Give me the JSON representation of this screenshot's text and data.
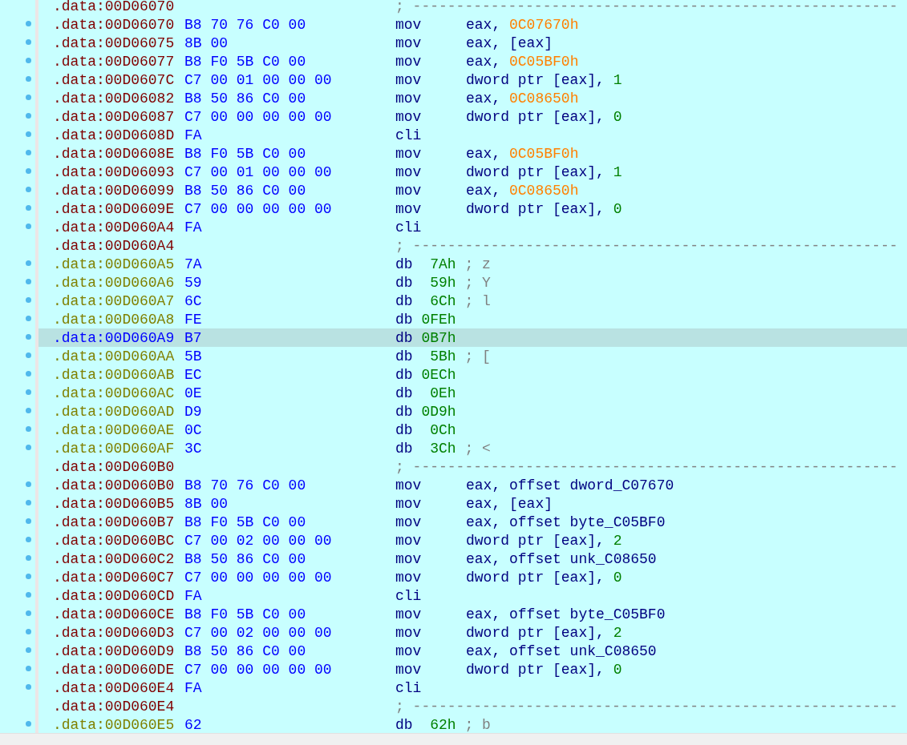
{
  "listing": [
    {
      "kind": "separator",
      "selected": false,
      "address": ".data:00D06070",
      "comment": "; --------------------------------------------------------"
    },
    {
      "kind": "code",
      "selected": false,
      "address": ".data:00D06070",
      "bytes": "B8 70 76 C0 00",
      "mnemonic": "mov",
      "operands": [
        {
          "text": "eax, ",
          "kind": "plain"
        },
        {
          "text": "0C07670h",
          "kind": "address"
        }
      ]
    },
    {
      "kind": "code",
      "selected": false,
      "address": ".data:00D06075",
      "bytes": "8B 00",
      "mnemonic": "mov",
      "operands": [
        {
          "text": "eax, [eax]",
          "kind": "plain"
        }
      ]
    },
    {
      "kind": "code",
      "selected": false,
      "address": ".data:00D06077",
      "bytes": "B8 F0 5B C0 00",
      "mnemonic": "mov",
      "operands": [
        {
          "text": "eax, ",
          "kind": "plain"
        },
        {
          "text": "0C05BF0h",
          "kind": "address"
        }
      ]
    },
    {
      "kind": "code",
      "selected": false,
      "address": ".data:00D0607C",
      "bytes": "C7 00 01 00 00 00",
      "mnemonic": "mov",
      "operands": [
        {
          "text": "dword ptr [eax], ",
          "kind": "plain"
        },
        {
          "text": "1",
          "kind": "number"
        }
      ]
    },
    {
      "kind": "code",
      "selected": false,
      "address": ".data:00D06082",
      "bytes": "B8 50 86 C0 00",
      "mnemonic": "mov",
      "operands": [
        {
          "text": "eax, ",
          "kind": "plain"
        },
        {
          "text": "0C08650h",
          "kind": "address"
        }
      ]
    },
    {
      "kind": "code",
      "selected": false,
      "address": ".data:00D06087",
      "bytes": "C7 00 00 00 00 00",
      "mnemonic": "mov",
      "operands": [
        {
          "text": "dword ptr [eax], ",
          "kind": "plain"
        },
        {
          "text": "0",
          "kind": "number"
        }
      ]
    },
    {
      "kind": "code",
      "selected": false,
      "address": ".data:00D0608D",
      "bytes": "FA",
      "mnemonic": "cli"
    },
    {
      "kind": "code",
      "selected": false,
      "address": ".data:00D0608E",
      "bytes": "B8 F0 5B C0 00",
      "mnemonic": "mov",
      "operands": [
        {
          "text": "eax, ",
          "kind": "plain"
        },
        {
          "text": "0C05BF0h",
          "kind": "address"
        }
      ]
    },
    {
      "kind": "code",
      "selected": false,
      "address": ".data:00D06093",
      "bytes": "C7 00 01 00 00 00",
      "mnemonic": "mov",
      "operands": [
        {
          "text": "dword ptr [eax], ",
          "kind": "plain"
        },
        {
          "text": "1",
          "kind": "number"
        }
      ]
    },
    {
      "kind": "code",
      "selected": false,
      "address": ".data:00D06099",
      "bytes": "B8 50 86 C0 00",
      "mnemonic": "mov",
      "operands": [
        {
          "text": "eax, ",
          "kind": "plain"
        },
        {
          "text": "0C08650h",
          "kind": "address"
        }
      ]
    },
    {
      "kind": "code",
      "selected": false,
      "address": ".data:00D0609E",
      "bytes": "C7 00 00 00 00 00",
      "mnemonic": "mov",
      "operands": [
        {
          "text": "dword ptr [eax], ",
          "kind": "plain"
        },
        {
          "text": "0",
          "kind": "number"
        }
      ]
    },
    {
      "kind": "code",
      "selected": false,
      "address": ".data:00D060A4",
      "bytes": "FA",
      "mnemonic": "cli"
    },
    {
      "kind": "separator",
      "selected": false,
      "address": ".data:00D060A4",
      "comment": "; --------------------------------------------------------"
    },
    {
      "kind": "data",
      "selected": false,
      "address": ".data:00D060A5",
      "bytes": "7A",
      "mnemonic": "db",
      "value": "7Ah",
      "comment": "; z"
    },
    {
      "kind": "data",
      "selected": false,
      "address": ".data:00D060A6",
      "bytes": "59",
      "mnemonic": "db",
      "value": "59h",
      "comment": "; Y"
    },
    {
      "kind": "data",
      "selected": false,
      "address": ".data:00D060A7",
      "bytes": "6C",
      "mnemonic": "db",
      "value": "6Ch",
      "comment": "; l"
    },
    {
      "kind": "data",
      "selected": false,
      "address": ".data:00D060A8",
      "bytes": "FE",
      "mnemonic": "db",
      "value": "0FEh"
    },
    {
      "kind": "data",
      "selected": true,
      "address": ".data:00D060A9",
      "bytes": "B7",
      "mnemonic": "db",
      "value": "0B7h"
    },
    {
      "kind": "data",
      "selected": false,
      "address": ".data:00D060AA",
      "bytes": "5B",
      "mnemonic": "db",
      "value": "5Bh",
      "comment": "; ["
    },
    {
      "kind": "data",
      "selected": false,
      "address": ".data:00D060AB",
      "bytes": "EC",
      "mnemonic": "db",
      "value": "0ECh"
    },
    {
      "kind": "data",
      "selected": false,
      "address": ".data:00D060AC",
      "bytes": "0E",
      "mnemonic": "db",
      "value": "0Eh"
    },
    {
      "kind": "data",
      "selected": false,
      "address": ".data:00D060AD",
      "bytes": "D9",
      "mnemonic": "db",
      "value": "0D9h"
    },
    {
      "kind": "data",
      "selected": false,
      "address": ".data:00D060AE",
      "bytes": "0C",
      "mnemonic": "db",
      "value": "0Ch"
    },
    {
      "kind": "data",
      "selected": false,
      "address": ".data:00D060AF",
      "bytes": "3C",
      "mnemonic": "db",
      "value": "3Ch",
      "comment": "; <"
    },
    {
      "kind": "separator",
      "selected": false,
      "address": ".data:00D060B0",
      "comment": "; --------------------------------------------------------"
    },
    {
      "kind": "code",
      "selected": false,
      "address": ".data:00D060B0",
      "bytes": "B8 70 76 C0 00",
      "mnemonic": "mov",
      "operands": [
        {
          "text": "eax, offset dword_C07670",
          "kind": "plain"
        }
      ]
    },
    {
      "kind": "code",
      "selected": false,
      "address": ".data:00D060B5",
      "bytes": "8B 00",
      "mnemonic": "mov",
      "operands": [
        {
          "text": "eax, [eax]",
          "kind": "plain"
        }
      ]
    },
    {
      "kind": "code",
      "selected": false,
      "address": ".data:00D060B7",
      "bytes": "B8 F0 5B C0 00",
      "mnemonic": "mov",
      "operands": [
        {
          "text": "eax, offset byte_C05BF0",
          "kind": "plain"
        }
      ]
    },
    {
      "kind": "code",
      "selected": false,
      "address": ".data:00D060BC",
      "bytes": "C7 00 02 00 00 00",
      "mnemonic": "mov",
      "operands": [
        {
          "text": "dword ptr [eax], ",
          "kind": "plain"
        },
        {
          "text": "2",
          "kind": "number"
        }
      ]
    },
    {
      "kind": "code",
      "selected": false,
      "address": ".data:00D060C2",
      "bytes": "B8 50 86 C0 00",
      "mnemonic": "mov",
      "operands": [
        {
          "text": "eax, offset unk_C08650",
          "kind": "plain"
        }
      ]
    },
    {
      "kind": "code",
      "selected": false,
      "address": ".data:00D060C7",
      "bytes": "C7 00 00 00 00 00",
      "mnemonic": "mov",
      "operands": [
        {
          "text": "dword ptr [eax], ",
          "kind": "plain"
        },
        {
          "text": "0",
          "kind": "number"
        }
      ]
    },
    {
      "kind": "code",
      "selected": false,
      "address": ".data:00D060CD",
      "bytes": "FA",
      "mnemonic": "cli"
    },
    {
      "kind": "code",
      "selected": false,
      "address": ".data:00D060CE",
      "bytes": "B8 F0 5B C0 00",
      "mnemonic": "mov",
      "operands": [
        {
          "text": "eax, offset byte_C05BF0",
          "kind": "plain"
        }
      ]
    },
    {
      "kind": "code",
      "selected": false,
      "address": ".data:00D060D3",
      "bytes": "C7 00 02 00 00 00",
      "mnemonic": "mov",
      "operands": [
        {
          "text": "dword ptr [eax], ",
          "kind": "plain"
        },
        {
          "text": "2",
          "kind": "number"
        }
      ]
    },
    {
      "kind": "code",
      "selected": false,
      "address": ".data:00D060D9",
      "bytes": "B8 50 86 C0 00",
      "mnemonic": "mov",
      "operands": [
        {
          "text": "eax, offset unk_C08650",
          "kind": "plain"
        }
      ]
    },
    {
      "kind": "code",
      "selected": false,
      "address": ".data:00D060DE",
      "bytes": "C7 00 00 00 00 00",
      "mnemonic": "mov",
      "operands": [
        {
          "text": "dword ptr [eax], ",
          "kind": "plain"
        },
        {
          "text": "0",
          "kind": "number"
        }
      ]
    },
    {
      "kind": "code",
      "selected": false,
      "address": ".data:00D060E4",
      "bytes": "FA",
      "mnemonic": "cli"
    },
    {
      "kind": "separator",
      "selected": false,
      "address": ".data:00D060E4",
      "comment": "; --------------------------------------------------------"
    },
    {
      "kind": "data",
      "selected": false,
      "address": ".data:00D060E5",
      "bytes": "62",
      "mnemonic": "db",
      "value": "62h",
      "comment": "; b"
    }
  ]
}
